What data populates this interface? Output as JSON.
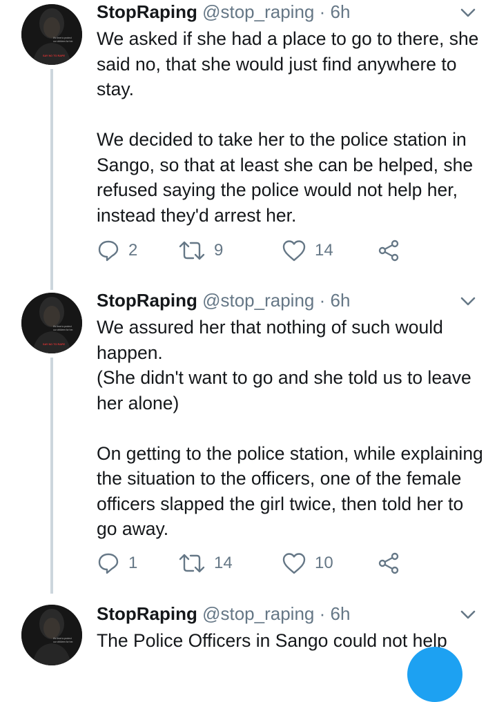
{
  "tweets": [
    {
      "author_name": "StopRaping",
      "handle": "@stop_raping",
      "separator": "·",
      "time": "6h",
      "paragraphs": [
        "We asked if she had a place to go to there, she said no, that she would just find anywhere to stay.",
        "We decided to take her to the police station in Sango, so that at least she can be helped, she refused saying the police would not help her, instead they'd arrest her."
      ],
      "replies": "2",
      "retweets": "9",
      "likes": "14"
    },
    {
      "author_name": "StopRaping",
      "handle": "@stop_raping",
      "separator": "·",
      "time": "6h",
      "paragraphs": [
        "We assured her that nothing of such would happen.\n(She didn't want to go and she told us to leave her alone)",
        "On getting to the police station, while explaining the situation to the officers, one of the female officers slapped the girl twice, then told her to go away."
      ],
      "replies": "1",
      "retweets": "14",
      "likes": "10"
    },
    {
      "author_name": "StopRaping",
      "handle": "@stop_raping",
      "separator": "·",
      "time": "6h",
      "paragraphs": [
        "The Police Officers in Sango could not help"
      ]
    }
  ],
  "avatar": {
    "caption_lines": [
      "It's time to protect",
      "our children for her."
    ],
    "banner_text": "SAY NO TO RAPE"
  },
  "icons": {
    "reply": "reply-icon",
    "retweet": "retweet-icon",
    "like": "heart-icon",
    "share": "share-icon",
    "menu": "chevron-down-icon"
  },
  "colors": {
    "text": "#14171a",
    "secondary": "#657786",
    "thread_line": "#ccd6dd",
    "accent": "#1da1f2"
  }
}
